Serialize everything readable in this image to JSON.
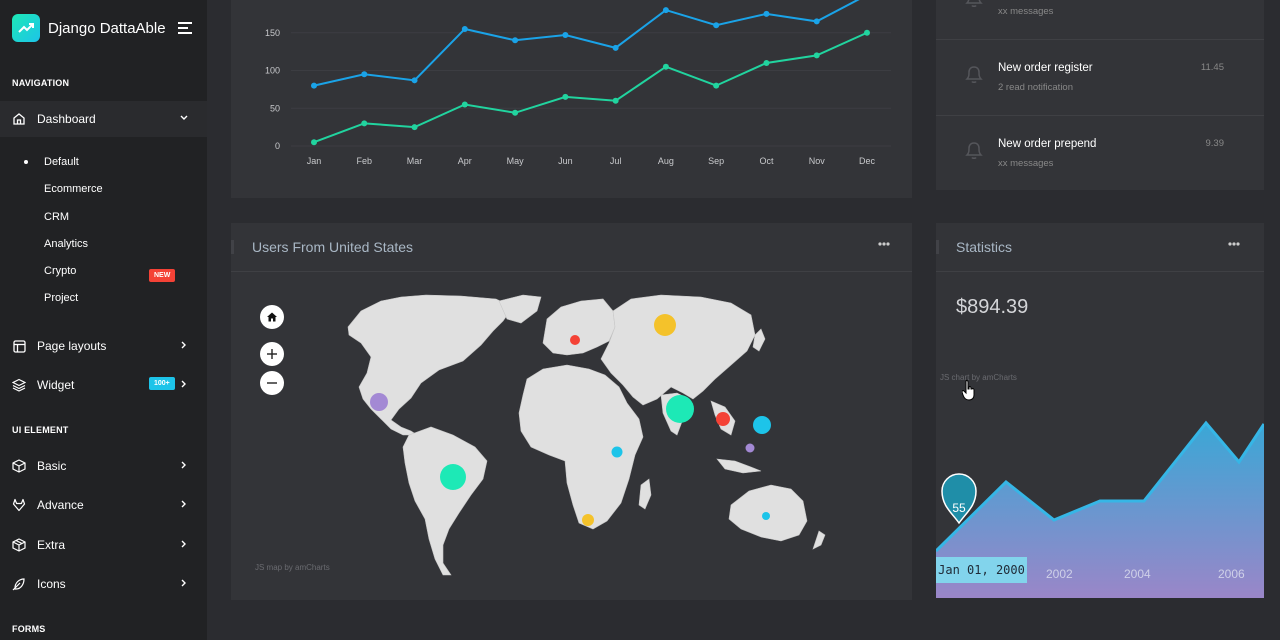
{
  "brand": {
    "name": "Django DattaAble",
    "icon": "trending-up-icon"
  },
  "sidebar": {
    "captions": [
      "NAVIGATION",
      "UI ELEMENT",
      "FORMS"
    ],
    "dashboard": {
      "label": "Dashboard",
      "icon": "home-icon"
    },
    "submenu": [
      "Default",
      "Ecommerce",
      "CRM",
      "Analytics",
      "Crypto",
      "Project"
    ],
    "crypto_badge": "NEW",
    "items": [
      {
        "label": "Page layouts",
        "icon": "layout-icon"
      },
      {
        "label": "Widget",
        "icon": "layers-icon",
        "badge": "100+"
      },
      {
        "label": "Basic",
        "icon": "box-icon"
      },
      {
        "label": "Advance",
        "icon": "gitlab-icon"
      },
      {
        "label": "Extra",
        "icon": "package-icon"
      },
      {
        "label": "Icons",
        "icon": "feather-icon"
      }
    ]
  },
  "notifications": [
    {
      "title": "",
      "sub": "xx messages",
      "time": ""
    },
    {
      "title": "New order register",
      "sub": "2 read notification",
      "time": "11.45"
    },
    {
      "title": "New order prepend",
      "sub": "xx messages",
      "time": "9.39"
    }
  ],
  "map_card": {
    "title": "Users From United States",
    "credit": "JS map by amCharts"
  },
  "stats_card": {
    "title": "Statistics",
    "value": "$894.39",
    "credit": "JS chart by amCharts",
    "bubble": "55",
    "date_label": "Jan 01, 2000",
    "years": [
      "2002",
      "2004",
      "2006"
    ]
  },
  "colors": {
    "accent_teal": "#1de9b6",
    "accent_blue": "#1dc4e9",
    "line_blue": "#1aa3e8",
    "line_green": "#21d49f",
    "card_bg": "#333438",
    "sidebar_bg": "#212224"
  },
  "chart_data": {
    "type": "line",
    "categories": [
      "Jan",
      "Feb",
      "Mar",
      "Apr",
      "May",
      "Jun",
      "Jul",
      "Aug",
      "Sep",
      "Oct",
      "Nov",
      "Dec"
    ],
    "y_ticks": [
      0,
      50,
      100,
      150
    ],
    "ylim": [
      0,
      200
    ],
    "series": [
      {
        "values": [
          80,
          95,
          87,
          155,
          140,
          147,
          130,
          180,
          160,
          175,
          165,
          200
        ],
        "color": "#1aa3e8"
      },
      {
        "values": [
          5,
          30,
          25,
          55,
          44,
          65,
          60,
          105,
          80,
          110,
          120,
          150
        ],
        "color": "#21d49f"
      }
    ]
  }
}
